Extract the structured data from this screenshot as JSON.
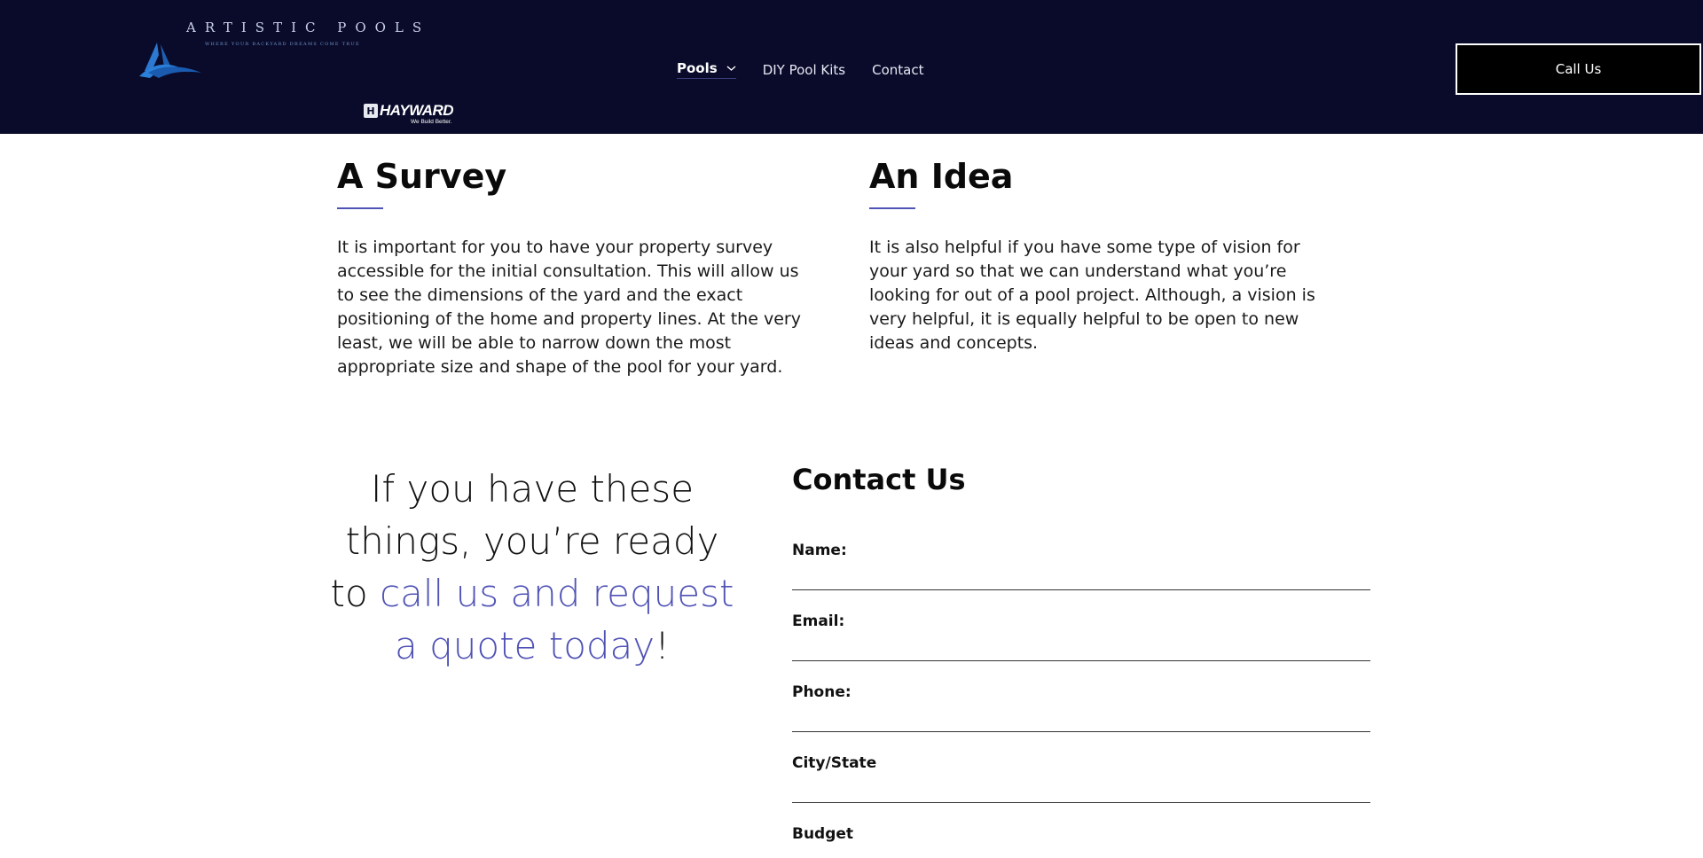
{
  "header": {
    "logo_text": "ARTISTIC POOLS",
    "logo_tagline": "WHERE YOUR BACKYARD DREAMS COME TRUE",
    "nav": [
      {
        "label": "Pools",
        "has_dropdown": true,
        "active": true
      },
      {
        "label": "DIY Pool Kits"
      },
      {
        "label": "Contact"
      }
    ],
    "call_button": "Call Us",
    "partner_logo": {
      "name": "HAYWARD",
      "tagline": "We Build Better."
    }
  },
  "columns": [
    {
      "title": "A Survey",
      "body": "It is important for you to have your property survey accessible for the initial consultation.  This will allow us to see the dimensions of the yard and the exact positioning of the home and property lines.  At the very least, we will be able to narrow down the most appropriate size and shape of the pool for your yard."
    },
    {
      "title": "An Idea",
      "body": "It is also helpful if you have some type of vision for your yard so that we can understand what you’re looking for out of a pool project.  Although, a vision is very helpful, it is equally helpful to be open to new ideas and concepts."
    }
  ],
  "promo": {
    "lead": "If you have these things, you’re ready to ",
    "highlight": "call us and request a quote today",
    "tail": "!"
  },
  "contact": {
    "title": "Contact Us",
    "fields": [
      {
        "label": "Name:",
        "value": ""
      },
      {
        "label": "Email:",
        "value": ""
      },
      {
        "label": "Phone:",
        "value": ""
      },
      {
        "label": "City/State",
        "value": ""
      },
      {
        "label": "Budget",
        "value": ""
      }
    ]
  },
  "colors": {
    "header_bg": "#0a0b2a",
    "accent": "#4f52b5",
    "button_bg": "#000000"
  }
}
